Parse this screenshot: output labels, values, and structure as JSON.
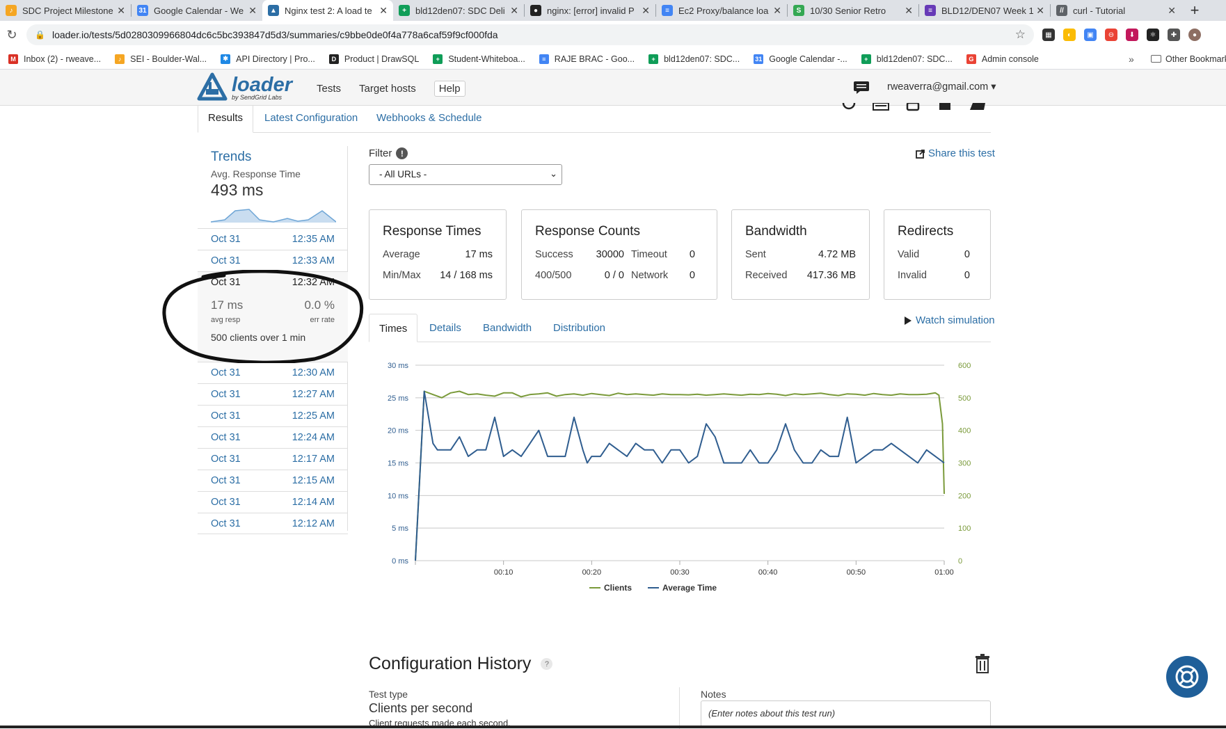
{
  "browser": {
    "tabs": [
      {
        "label": "SDC Project Milestone",
        "icon_color": "#f5a623",
        "icon_char": "♪",
        "active": false
      },
      {
        "label": "Google Calendar - We",
        "icon_color": "#4285f4",
        "icon_char": "31",
        "active": false
      },
      {
        "label": "Nginx test 2: A load te",
        "icon_color": "#2c6ea5",
        "icon_char": "▲",
        "active": true
      },
      {
        "label": "bld12den07: SDC Deli",
        "icon_color": "#0f9d58",
        "icon_char": "+",
        "active": false
      },
      {
        "label": "nginx: [error] invalid P",
        "icon_color": "#222222",
        "icon_char": "●",
        "active": false
      },
      {
        "label": "Ec2 Proxy/balance loa",
        "icon_color": "#4285f4",
        "icon_char": "≡",
        "active": false
      },
      {
        "label": "10/30 Senior Retro",
        "icon_color": "#34a853",
        "icon_char": "S",
        "active": false
      },
      {
        "label": "BLD12/DEN07 Week 1",
        "icon_color": "#673ab7",
        "icon_char": "≡",
        "active": false
      },
      {
        "label": "curl - Tutorial",
        "icon_color": "#5f6368",
        "icon_char": "//",
        "active": false
      }
    ],
    "url": "loader.io/tests/5d0280309966804dc6c5bc393847d5d3/summaries/c9bbe0de0f4a778a6caf59f9cf000fda",
    "bookmarks": [
      {
        "label": "Inbox (2) - rweave...",
        "icon_color": "#d93025",
        "icon_char": "M"
      },
      {
        "label": "SEI - Boulder-Wal...",
        "icon_color": "#f5a623",
        "icon_char": "♪"
      },
      {
        "label": "API Directory | Pro...",
        "icon_color": "#1e88e5",
        "icon_char": "✱"
      },
      {
        "label": "Product | DrawSQL",
        "icon_color": "#222222",
        "icon_char": "D"
      },
      {
        "label": "Student-Whiteboa...",
        "icon_color": "#0f9d58",
        "icon_char": "+"
      },
      {
        "label": "RAJE BRAC - Goo...",
        "icon_color": "#4285f4",
        "icon_char": "≡"
      },
      {
        "label": "bld12den07: SDC...",
        "icon_color": "#0f9d58",
        "icon_char": "+"
      },
      {
        "label": "Google Calendar -...",
        "icon_color": "#4285f4",
        "icon_char": "31"
      },
      {
        "label": "bld12den07: SDC...",
        "icon_color": "#0f9d58",
        "icon_char": "+"
      },
      {
        "label": "Admin console",
        "icon_color": "#ea4335",
        "icon_char": "G"
      }
    ],
    "more_bookmarks": "»",
    "other_bookmarks": "Other Bookmarks"
  },
  "app": {
    "logo_text": "loader",
    "logo_sub": "by SendGrid Labs",
    "nav": {
      "tests": "Tests",
      "target_hosts": "Target hosts",
      "help": "Help"
    },
    "user_email": "rweaverra@gmail.com ▾"
  },
  "subtabs": {
    "results": "Results",
    "latest_config": "Latest Configuration",
    "webhooks": "Webhooks & Schedule"
  },
  "sidebar": {
    "trends_title": "Trends",
    "trends_sub": "Avg. Response Time",
    "trends_value": "493 ms",
    "runs_before": [
      {
        "date": "Oct 31",
        "time": "12:35 AM"
      },
      {
        "date": "Oct 31",
        "time": "12:33 AM"
      }
    ],
    "selected_run": {
      "date": "Oct 31",
      "time": "12:32 AM",
      "avg": "17 ms",
      "avg_label": "avg resp",
      "err": "0.0 %",
      "err_label": "err rate",
      "clients_count": "500",
      "clients_mid": " clients over ",
      "clients_dur": "1",
      "clients_unit": " min"
    },
    "runs_after": [
      {
        "date": "Oct 31",
        "time": "12:30 AM"
      },
      {
        "date": "Oct 31",
        "time": "12:27 AM"
      },
      {
        "date": "Oct 31",
        "time": "12:25 AM"
      },
      {
        "date": "Oct 31",
        "time": "12:24 AM"
      },
      {
        "date": "Oct 31",
        "time": "12:17 AM"
      },
      {
        "date": "Oct 31",
        "time": "12:15 AM"
      },
      {
        "date": "Oct 31",
        "time": "12:14 AM"
      },
      {
        "date": "Oct 31",
        "time": "12:12 AM"
      }
    ]
  },
  "filter": {
    "label": "Filter",
    "selected": "- All URLs -"
  },
  "share_label": "Share this test",
  "cards": {
    "response_times": {
      "title": "Response Times",
      "average_label": "Average",
      "average": "17 ms",
      "minmax_label": "Min/Max",
      "minmax": "14 / 168 ms"
    },
    "response_counts": {
      "title": "Response Counts",
      "success_label": "Success",
      "success": "30000",
      "timeout_label": "Timeout",
      "timeout": "0",
      "err_label": "400/500",
      "err": "0 / 0",
      "network_label": "Network",
      "network": "0"
    },
    "bandwidth": {
      "title": "Bandwidth",
      "sent_label": "Sent",
      "sent": "4.72 MB",
      "received_label": "Received",
      "received": "417.36 MB"
    },
    "redirects": {
      "title": "Redirects",
      "valid_label": "Valid",
      "valid": "0",
      "invalid_label": "Invalid",
      "invalid": "0"
    }
  },
  "chart_tabs": {
    "times": "Times",
    "details": "Details",
    "bandwidth": "Bandwidth",
    "distribution": "Distribution"
  },
  "watch_simulation": "Watch simulation",
  "chart_data": {
    "type": "line",
    "left_axis": {
      "ticks": [
        "0 ms",
        "5 ms",
        "10 ms",
        "15 ms",
        "20 ms",
        "25 ms",
        "30 ms"
      ],
      "range": [
        0,
        30
      ]
    },
    "right_axis": {
      "ticks": [
        "0",
        "100",
        "200",
        "300",
        "400",
        "500",
        "600"
      ],
      "range": [
        0,
        600
      ]
    },
    "x_ticks": [
      "00:10",
      "00:20",
      "00:30",
      "00:40",
      "00:50",
      "01:00"
    ],
    "x_range": [
      0,
      60
    ],
    "colors": {
      "clients": "#7a9a3a",
      "avg_time": "#2f5d8f"
    },
    "series": [
      {
        "name": "Clients",
        "axis": "right",
        "x": [
          0,
          1,
          2,
          3,
          4,
          5,
          6,
          7,
          8,
          9,
          10,
          11,
          12,
          13,
          14,
          15,
          16,
          17,
          18,
          19,
          20,
          21,
          22,
          23,
          24,
          25,
          26,
          27,
          28,
          29,
          30,
          31,
          32,
          33,
          34,
          35,
          36,
          37,
          38,
          39,
          40,
          41,
          42,
          43,
          44,
          45,
          46,
          47,
          48,
          49,
          50,
          51,
          52,
          53,
          54,
          55,
          56,
          57,
          58,
          59,
          59.4,
          59.8,
          60
        ],
        "values": [
          0,
          520,
          510,
          500,
          515,
          520,
          510,
          512,
          508,
          505,
          515,
          515,
          503,
          510,
          512,
          515,
          505,
          510,
          512,
          508,
          513,
          510,
          507,
          514,
          510,
          512,
          510,
          508,
          512,
          510,
          510,
          509,
          511,
          508,
          510,
          512,
          510,
          508,
          511,
          510,
          513,
          511,
          507,
          512,
          510,
          512,
          514,
          510,
          507,
          512,
          511,
          508,
          513,
          510,
          508,
          512,
          510,
          510,
          511,
          515,
          508,
          420,
          205
        ]
      },
      {
        "name": "Average Time",
        "axis": "left",
        "x": [
          0,
          1,
          2,
          2.5,
          3,
          4,
          5,
          6,
          7,
          8,
          9,
          9.5,
          10,
          11,
          12,
          13,
          14,
          15,
          16,
          17,
          18,
          19,
          19.5,
          20,
          21,
          22,
          23,
          24,
          25,
          26,
          27,
          28,
          29,
          30,
          31,
          32,
          33,
          34,
          35,
          36,
          37,
          38,
          39,
          40,
          41,
          42,
          43,
          44,
          45,
          46,
          47,
          48,
          49,
          50,
          51,
          52,
          53,
          54,
          55,
          56,
          57,
          58,
          59,
          60
        ],
        "values": [
          0,
          26,
          18,
          17,
          17,
          17,
          19,
          16,
          17,
          17,
          22,
          19,
          16,
          17,
          16,
          18,
          20,
          16,
          16,
          16,
          22,
          17,
          15,
          16,
          16,
          18,
          17,
          16,
          18,
          17,
          17,
          15,
          17,
          17,
          15,
          16,
          21,
          19,
          15,
          15,
          15,
          17,
          15,
          15,
          17,
          21,
          17,
          15,
          15,
          17,
          16,
          16,
          22,
          15,
          16,
          17,
          17,
          18,
          17,
          16,
          15,
          17,
          16,
          15
        ]
      }
    ],
    "legend": [
      {
        "name": "Clients",
        "color": "#7a9a3a"
      },
      {
        "name": "Average Time",
        "color": "#2f5d8f"
      }
    ],
    "legend_position": "bottom"
  },
  "config_history": {
    "title": "Configuration History",
    "help": "?",
    "test_type_label": "Test type",
    "test_type_value": "Clients per second",
    "test_type_desc": "Client requests made each second.",
    "notes_label": "Notes",
    "notes_placeholder": "(Enter notes about this test run)"
  }
}
